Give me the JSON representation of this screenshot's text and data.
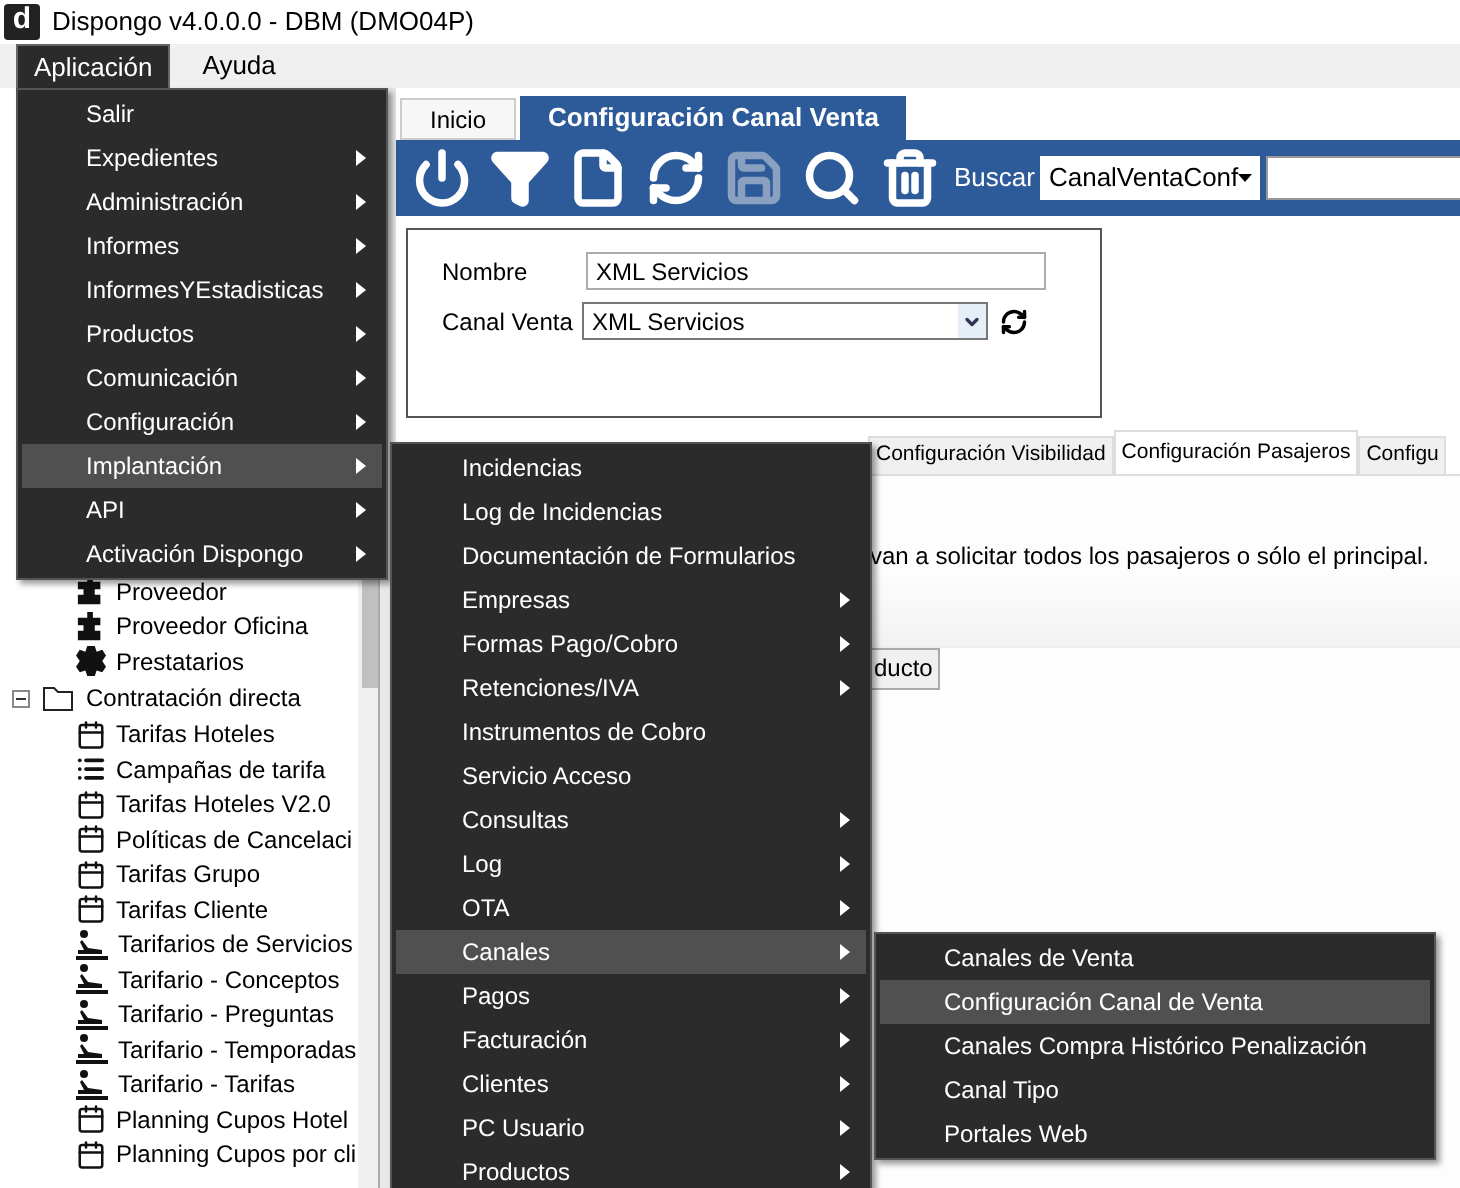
{
  "window": {
    "title": "Dispongo v4.0.0.0 - DBM (DMO04P)",
    "logo": "d"
  },
  "menubar": [
    {
      "label": "Aplicación",
      "selected": true
    },
    {
      "label": "Ayuda",
      "selected": false
    }
  ],
  "app_menu": [
    {
      "label": "Salir",
      "submenu": false,
      "selected": false
    },
    {
      "label": "Expedientes",
      "submenu": true,
      "selected": false
    },
    {
      "label": "Administración",
      "submenu": true,
      "selected": false
    },
    {
      "label": "Informes",
      "submenu": true,
      "selected": false
    },
    {
      "label": "InformesYEstadisticas",
      "submenu": true,
      "selected": false
    },
    {
      "label": "Productos",
      "submenu": true,
      "selected": false
    },
    {
      "label": "Comunicación",
      "submenu": true,
      "selected": false
    },
    {
      "label": "Configuración",
      "submenu": true,
      "selected": false
    },
    {
      "label": "Implantación",
      "submenu": true,
      "selected": true
    },
    {
      "label": "API",
      "submenu": true,
      "selected": false
    },
    {
      "label": "Activación Dispongo",
      "submenu": true,
      "selected": false
    }
  ],
  "implantacion_menu": [
    {
      "label": "Incidencias",
      "submenu": false,
      "selected": false
    },
    {
      "label": "Log de Incidencias",
      "submenu": false,
      "selected": false
    },
    {
      "label": "Documentación de Formularios",
      "submenu": false,
      "selected": false
    },
    {
      "label": "Empresas",
      "submenu": true,
      "selected": false
    },
    {
      "label": "Formas Pago/Cobro",
      "submenu": true,
      "selected": false
    },
    {
      "label": "Retenciones/IVA",
      "submenu": true,
      "selected": false
    },
    {
      "label": "Instrumentos de Cobro",
      "submenu": false,
      "selected": false
    },
    {
      "label": "Servicio Acceso",
      "submenu": false,
      "selected": false
    },
    {
      "label": "Consultas",
      "submenu": true,
      "selected": false
    },
    {
      "label": "Log",
      "submenu": true,
      "selected": false
    },
    {
      "label": "OTA",
      "submenu": true,
      "selected": false
    },
    {
      "label": "Canales",
      "submenu": true,
      "selected": true
    },
    {
      "label": "Pagos",
      "submenu": true,
      "selected": false
    },
    {
      "label": "Facturación",
      "submenu": true,
      "selected": false
    },
    {
      "label": "Clientes",
      "submenu": true,
      "selected": false
    },
    {
      "label": "PC Usuario",
      "submenu": true,
      "selected": false
    },
    {
      "label": "Productos",
      "submenu": true,
      "selected": false
    }
  ],
  "canales_menu": [
    {
      "label": "Canales de Venta",
      "selected": false
    },
    {
      "label": "Configuración Canal de Venta",
      "selected": true
    },
    {
      "label": "Canales Compra Histórico Penalización",
      "selected": false
    },
    {
      "label": "Canal Tipo",
      "selected": false
    },
    {
      "label": "Portales Web",
      "selected": false
    }
  ],
  "tree": {
    "hidden_parent_children": [
      {
        "label": "Proveedor",
        "kind": "puzzle"
      },
      {
        "label": "Proveedor Oficina",
        "kind": "puzzle"
      },
      {
        "label": "Prestatarios",
        "kind": "gear"
      }
    ],
    "nodes": [
      {
        "label": "Contratación directa",
        "expanded": true,
        "children": [
          {
            "label": "Tarifas Hoteles",
            "kind": "calendar"
          },
          {
            "label": "Campañas de tarifa",
            "kind": "list"
          },
          {
            "label": "Tarifas Hoteles V2.0",
            "kind": "calendar"
          },
          {
            "label": "Políticas de Cancelaci",
            "kind": "calendar"
          },
          {
            "label": "Tarifas Grupo",
            "kind": "calendar"
          },
          {
            "label": "Tarifas Cliente",
            "kind": "calendar"
          },
          {
            "label": "Tarifarios de Servicios",
            "kind": "figure"
          },
          {
            "label": "Tarifario - Conceptos",
            "kind": "figure"
          },
          {
            "label": "Tarifario - Preguntas",
            "kind": "figure"
          },
          {
            "label": "Tarifario - Temporadas",
            "kind": "figure"
          },
          {
            "label": "Tarifario - Tarifas",
            "kind": "figure"
          },
          {
            "label": "Planning Cupos Hotel",
            "kind": "calendar"
          },
          {
            "label": "Planning Cupos por cli",
            "kind": "calendar"
          }
        ]
      }
    ]
  },
  "doc_tabs": [
    {
      "label": "Inicio",
      "selected": false
    },
    {
      "label": "Configuración Canal Venta",
      "selected": true
    }
  ],
  "toolbar": {
    "buttons": [
      {
        "kind": "power",
        "disabled": false
      },
      {
        "kind": "filter",
        "disabled": false
      },
      {
        "kind": "new",
        "disabled": false
      },
      {
        "kind": "refresh",
        "disabled": false
      },
      {
        "kind": "save",
        "disabled": true
      },
      {
        "kind": "search",
        "disabled": false
      },
      {
        "kind": "delete",
        "disabled": false
      }
    ],
    "search_label": "Buscar",
    "search_table": "CanalVentaConf"
  },
  "form": {
    "nombre_label": "Nombre",
    "nombre_value": "XML Servicios",
    "canal_label": "Canal Venta",
    "canal_value": "XML Servicios"
  },
  "detail_tabs": [
    {
      "label": "Configuración Visibilidad",
      "selected": false
    },
    {
      "label": "Configuración Pasajeros",
      "selected": true
    },
    {
      "label": "Configu",
      "selected": false
    }
  ],
  "description": "van a solicitar todos los pasajeros o sólo el principal.",
  "product_button": "ducto"
}
